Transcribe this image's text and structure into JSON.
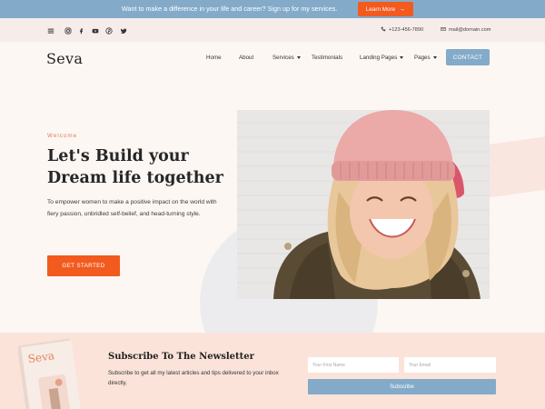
{
  "announcement": {
    "text": "Want to make a difference in your life and career? Sign up for my services.",
    "button_label": "Learn More",
    "button_icon": "arrow-right-icon"
  },
  "topbar": {
    "social_icons": [
      "menu-icon",
      "instagram-icon",
      "facebook-icon",
      "youtube-icon",
      "pinterest-icon",
      "twitter-icon"
    ],
    "phone": "+123-456-7890",
    "email": "mail@domain.com"
  },
  "header": {
    "logo": "Seva",
    "nav": {
      "home": "Home",
      "about": "About",
      "services": "Services",
      "testimonials": "Testimonials",
      "landing_pages": "Landing Pages",
      "pages": "Pages"
    },
    "contact_label": "CONTACT"
  },
  "hero": {
    "eyebrow": "Welcome",
    "headline_line1": "Let's Build your",
    "headline_line2": "Dream life together",
    "description": "To empower women to make a positive impact on the world with fiery passion, unbridled self-belief, and head-turning style.",
    "cta_label": "GET STARTED"
  },
  "newsletter": {
    "booklet_logo": "Seva",
    "title": "Subscribe To The Newsletter",
    "description": "Subscribe to get all my latest articles and tips delivered to your inbox directly.",
    "first_name_placeholder": "Your First Name",
    "email_placeholder": "Your Email",
    "button_label": "Subscribe"
  },
  "colors": {
    "accent_orange": "#f25a1e",
    "accent_blue": "#83abc9",
    "background": "#fdf7f4",
    "newsletter_bg": "#fbe3da"
  }
}
